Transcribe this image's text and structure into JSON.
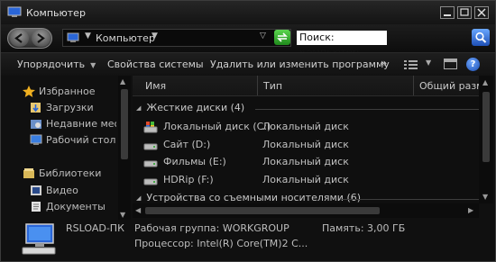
{
  "window": {
    "title": "Компьютер"
  },
  "address": {
    "path": "Компьютер",
    "search_value": "Поиск: Компьютер"
  },
  "toolbar": {
    "organize": "Упорядочить",
    "system_props": "Свойства системы",
    "uninstall": "Удалить или изменить программу",
    "more": "»"
  },
  "sidebar": {
    "items": [
      {
        "label": "Избранное",
        "icon": "star-icon"
      },
      {
        "label": "Загрузки",
        "icon": "downloads-icon"
      },
      {
        "label": "Недавние места",
        "icon": "recent-places-icon"
      },
      {
        "label": "Рабочий стол",
        "icon": "desktop-icon"
      },
      {
        "label": "Библиотеки",
        "icon": "libraries-icon"
      },
      {
        "label": "Видео",
        "icon": "video-icon"
      },
      {
        "label": "Документы",
        "icon": "documents-icon"
      }
    ]
  },
  "columns": {
    "name": "Имя",
    "type": "Тип",
    "total": "Общий разме"
  },
  "groups": {
    "hard_disks": "Жесткие диски (4)",
    "removable": "Устройства со съемными носителями (6)"
  },
  "drives": [
    {
      "name": "Локальный диск (C:)",
      "type": "Локальный диск"
    },
    {
      "name": "Сайт (D:)",
      "type": "Локальный диск"
    },
    {
      "name": "Фильмы (E:)",
      "type": "Локальный диск"
    },
    {
      "name": "HDRip (F:)",
      "type": "Локальный диск"
    }
  ],
  "details": {
    "computer_name": "RSLOAD-ПК",
    "workgroup": "Рабочая группа:  WORKGROUP",
    "memory": "Память:  3,00 ГБ",
    "processor": "Процессор:  Intel(R) Core(TM)2 C..."
  },
  "colors": {
    "background": "#101010",
    "accent_green": "#3cc43a",
    "accent_blue": "#2e6ee0"
  }
}
